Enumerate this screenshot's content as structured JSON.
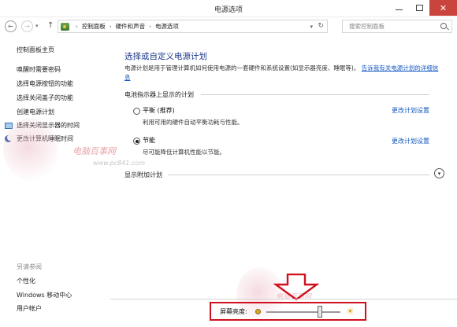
{
  "window": {
    "title": "电源选项",
    "close_glyph": "✕"
  },
  "address_bar": {
    "breadcrumb": [
      "控制面板",
      "硬件和声音",
      "电源选项"
    ],
    "separator": "›",
    "search_placeholder": "搜索控制面板"
  },
  "sidebar": {
    "home": "控制面板主页",
    "items": [
      "唤醒时需要密码",
      "选择电源按钮的功能",
      "选择关闭盖子的功能",
      "创建电源计划",
      "选择关闭显示器的时间",
      "更改计算机睡眠时间"
    ],
    "see_also_title": "另请参阅",
    "see_also": [
      "个性化",
      "Windows 移动中心",
      "用户帐户"
    ]
  },
  "main": {
    "heading": "选择或自定义电源计划",
    "description": "电源计划是用于管理计算机如何使用电源的一套硬件和系统设置(如显示器亮度、睡眠等)。",
    "description_link": "告诉我有关电源计划的详细信息",
    "group_label": "电池指示器上显示的计划",
    "plans": [
      {
        "name": "平衡 (推荐)",
        "desc": "利用可用的硬件自动平衡功耗与性能。",
        "link": "更改计划设置",
        "selected": false
      },
      {
        "name": "节能",
        "desc": "尽可能降低计算机性能以节能。",
        "link": "更改计划设置",
        "selected": true
      }
    ],
    "extra_plans": "显示附加计划"
  },
  "brightness": {
    "label": "屏幕亮度:",
    "level": 0.72
  },
  "watermark": {
    "text": "电脑百事网",
    "url": "www.pc841.com"
  },
  "colors": {
    "heading": "#1e3a8a",
    "link": "#1558c0",
    "close_button": "#c8443c",
    "highlight_border": "#d0101f"
  },
  "icons": [
    "back-arrow-icon",
    "forward-arrow-icon",
    "up-arrow-icon",
    "control-panel-icon",
    "refresh-icon",
    "search-icon",
    "monitor-icon",
    "moon-icon",
    "dim-sun-icon",
    "bright-sun-icon",
    "chevron-down-icon"
  ]
}
